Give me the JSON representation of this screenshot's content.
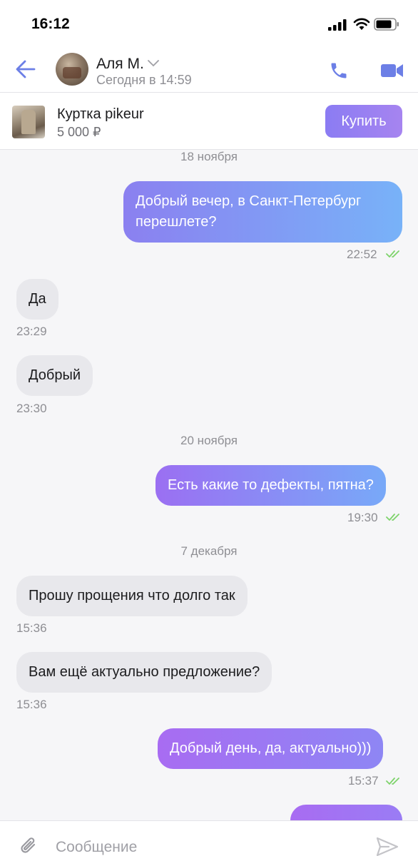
{
  "status_bar": {
    "time": "16:12"
  },
  "header": {
    "contact_name": "Аля М.",
    "last_seen": "Сегодня в 14:59"
  },
  "product": {
    "title": "Куртка pikeur",
    "price": "5 000 ₽",
    "buy_label": "Купить"
  },
  "messages": {
    "date_1": "18 ноября",
    "m1": {
      "text": "Добрый вечер, в Санкт-Петербург перешлете?",
      "time": "22:52",
      "direction": "outgoing",
      "read": true
    },
    "m2": {
      "text": "Да",
      "time": "23:29",
      "direction": "incoming"
    },
    "m3": {
      "text": "Добрый",
      "time": "23:30",
      "direction": "incoming"
    },
    "date_2": "20 ноября",
    "m4": {
      "text": "Есть какие то дефекты, пятна?",
      "time": "19:30",
      "direction": "outgoing",
      "read": true
    },
    "date_3": "7 декабря",
    "m5": {
      "text": "Прошу прощения что долго так",
      "time": "15:36",
      "direction": "incoming"
    },
    "m6": {
      "text": "Вам ещё актуально предложение?",
      "time": "15:36",
      "direction": "incoming"
    },
    "m7": {
      "text": "Добрый день, да, актуально)))",
      "time": "15:37",
      "direction": "outgoing",
      "read": true
    },
    "m8": {
      "text": "",
      "direction": "outgoing"
    }
  },
  "composer": {
    "placeholder": "Сообщение"
  },
  "colors": {
    "accent": "#6c7fe6",
    "outgoing_gradient_start": "#9b6ff2",
    "outgoing_gradient_end": "#76b0f8",
    "incoming_bubble": "#e8e8ec",
    "read_check": "#7ed36b"
  }
}
